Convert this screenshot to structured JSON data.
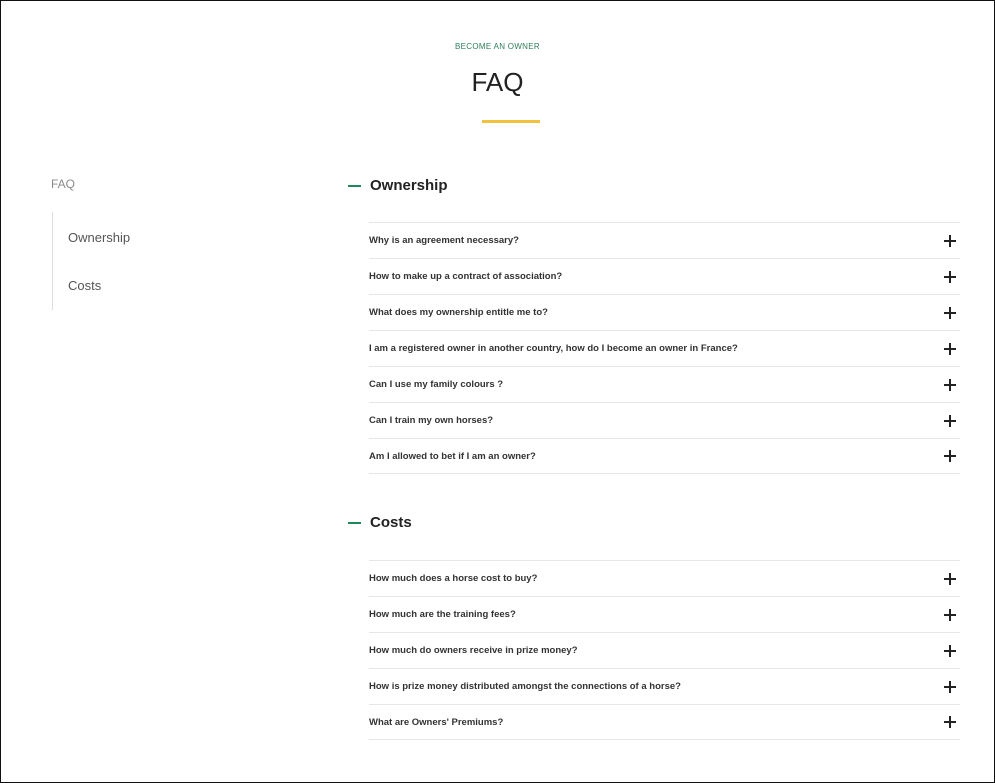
{
  "header": {
    "eyebrow": "BECOME AN OWNER",
    "title": "FAQ",
    "accent_color": "#f2c23f"
  },
  "sidebar": {
    "title": "FAQ",
    "items": [
      {
        "label": "Ownership"
      },
      {
        "label": "Costs"
      }
    ]
  },
  "sections": [
    {
      "title": "Ownership",
      "collapse_icon": "minus-icon",
      "questions": [
        {
          "text": "Why is an agreement necessary?",
          "icon": "plus-icon"
        },
        {
          "text": "How to make up a contract of association?",
          "icon": "plus-icon"
        },
        {
          "text": "What does my ownership entitle me to?",
          "icon": "plus-icon"
        },
        {
          "text": "I am a registered owner in another country, how do I become an owner in France?",
          "icon": "plus-icon"
        },
        {
          "text": "Can I use my family colours ?",
          "icon": "plus-icon"
        },
        {
          "text": "Can I train my own horses?",
          "icon": "plus-icon"
        },
        {
          "text": "Am I allowed to bet if I am an owner?",
          "icon": "plus-icon"
        }
      ]
    },
    {
      "title": "Costs",
      "collapse_icon": "minus-icon",
      "questions": [
        {
          "text": "How much does a horse cost to buy?",
          "icon": "plus-icon"
        },
        {
          "text": "How much are the training fees?",
          "icon": "plus-icon"
        },
        {
          "text": "How much do owners receive in prize money?",
          "icon": "plus-icon"
        },
        {
          "text": "How is prize money distributed amongst the connections of a horse?",
          "icon": "plus-icon"
        },
        {
          "text": "What are Owners' Premiums?",
          "icon": "plus-icon"
        }
      ]
    }
  ],
  "colors": {
    "brand_green": "#1c8a5a",
    "text_dark": "#222222",
    "divider": "#e6e6e6"
  }
}
